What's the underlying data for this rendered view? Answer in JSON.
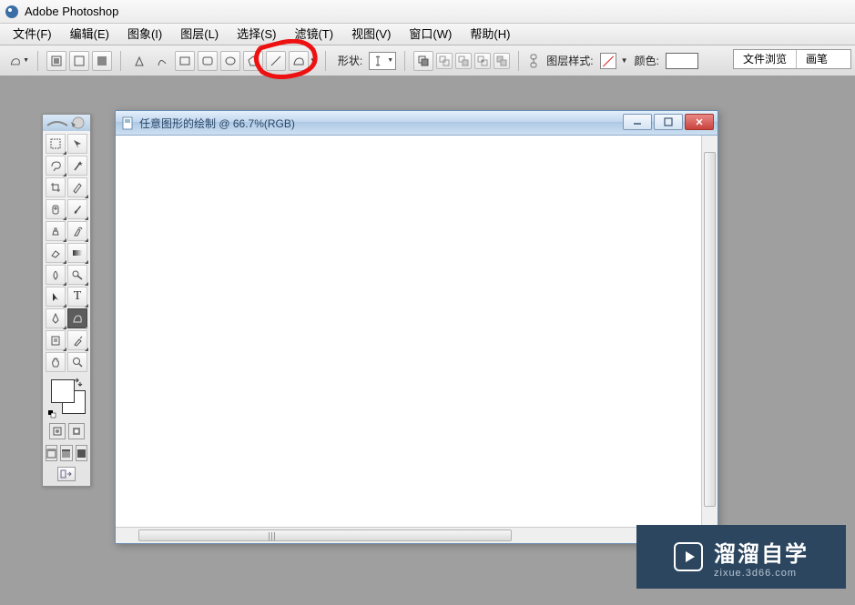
{
  "titlebar": {
    "title": "Adobe Photoshop"
  },
  "menu": {
    "file": "文件(F)",
    "edit": "编辑(E)",
    "image": "图象(I)",
    "layer": "图层(L)",
    "select": "选择(S)",
    "filter": "滤镜(T)",
    "view": "视图(V)",
    "window": "窗口(W)",
    "help": "帮助(H)"
  },
  "options": {
    "shape_label": "形状:",
    "layer_style_label": "图层样式:",
    "color_label": "颜色:",
    "filebrowse_tab": "文件浏览",
    "brushes_tab": "画笔"
  },
  "document": {
    "title": "任意图形的绘制 @ 66.7%(RGB)",
    "zoom_percent": 66.7,
    "mode": "RGB"
  },
  "watermark": {
    "main": "溜溜自学",
    "sub": "zixue.3d66.com"
  }
}
